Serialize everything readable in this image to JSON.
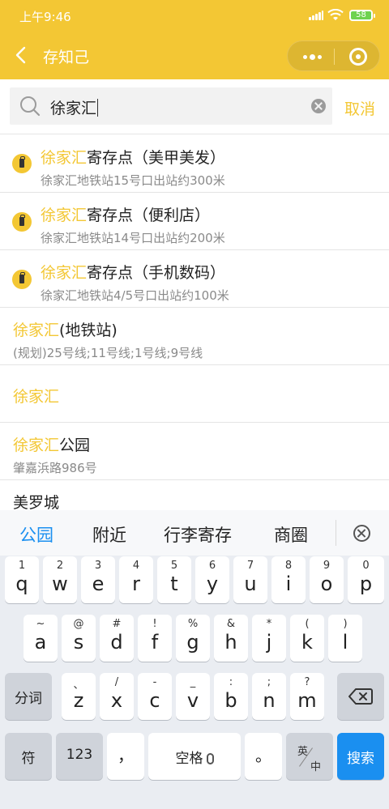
{
  "status": {
    "time": "上午9:46",
    "battery": "58"
  },
  "nav": {
    "title": "存知己"
  },
  "search": {
    "value": "徐家汇",
    "cancel": "取消"
  },
  "results": [
    {
      "hl": "徐家汇",
      "rest": "寄存点（美甲美发）",
      "sub": "徐家汇地铁站15号口出站约300米",
      "icon": "luggage-icon"
    },
    {
      "hl": "徐家汇",
      "rest": "寄存点（便利店）",
      "sub": "徐家汇地铁站14号口出站约200米",
      "icon": "luggage-icon"
    },
    {
      "hl": "徐家汇",
      "rest": "寄存点（手机数码）",
      "sub": "徐家汇地铁站4/5号口出站约100米",
      "icon": "luggage-icon"
    },
    {
      "hl": "徐家汇",
      "rest": "(地铁站)",
      "sub": "(规划)25号线;11号线;1号线;9号线"
    },
    {
      "hl": "徐家汇",
      "rest": "",
      "sub": ""
    },
    {
      "hl": "徐家汇",
      "rest": "公园",
      "sub": "肇嘉浜路986号"
    },
    {
      "hl": "",
      "rest": "美罗城",
      "sub": ""
    }
  ],
  "keyboard": {
    "suggestions": [
      "公园",
      "附近",
      "行李寄存",
      "商圈"
    ],
    "row1": [
      {
        "hint": "1",
        "key": "q"
      },
      {
        "hint": "2",
        "key": "w"
      },
      {
        "hint": "3",
        "key": "e"
      },
      {
        "hint": "4",
        "key": "r"
      },
      {
        "hint": "5",
        "key": "t"
      },
      {
        "hint": "6",
        "key": "y"
      },
      {
        "hint": "7",
        "key": "u"
      },
      {
        "hint": "8",
        "key": "i"
      },
      {
        "hint": "9",
        "key": "o"
      },
      {
        "hint": "0",
        "key": "p"
      }
    ],
    "row2": [
      {
        "hint": "~",
        "key": "a"
      },
      {
        "hint": "@",
        "key": "s"
      },
      {
        "hint": "#",
        "key": "d"
      },
      {
        "hint": "!",
        "key": "f"
      },
      {
        "hint": "%",
        "key": "g"
      },
      {
        "hint": "&",
        "key": "h"
      },
      {
        "hint": "*",
        "key": "j"
      },
      {
        "hint": "(",
        "key": "k"
      },
      {
        "hint": ")",
        "key": "l"
      }
    ],
    "row3": [
      {
        "hint": "、",
        "key": "z"
      },
      {
        "hint": "/",
        "key": "x"
      },
      {
        "hint": "-",
        "key": "c"
      },
      {
        "hint": "_",
        "key": "v"
      },
      {
        "hint": ":",
        "key": "b"
      },
      {
        "hint": ";",
        "key": "n"
      },
      {
        "hint": "?",
        "key": "m"
      }
    ],
    "fenci": "分词",
    "symbol": "符",
    "num": "123",
    "comma": "，",
    "space": "空格",
    "period": "。",
    "lang_top": "英",
    "lang_bottom": "中",
    "search": "搜索"
  }
}
